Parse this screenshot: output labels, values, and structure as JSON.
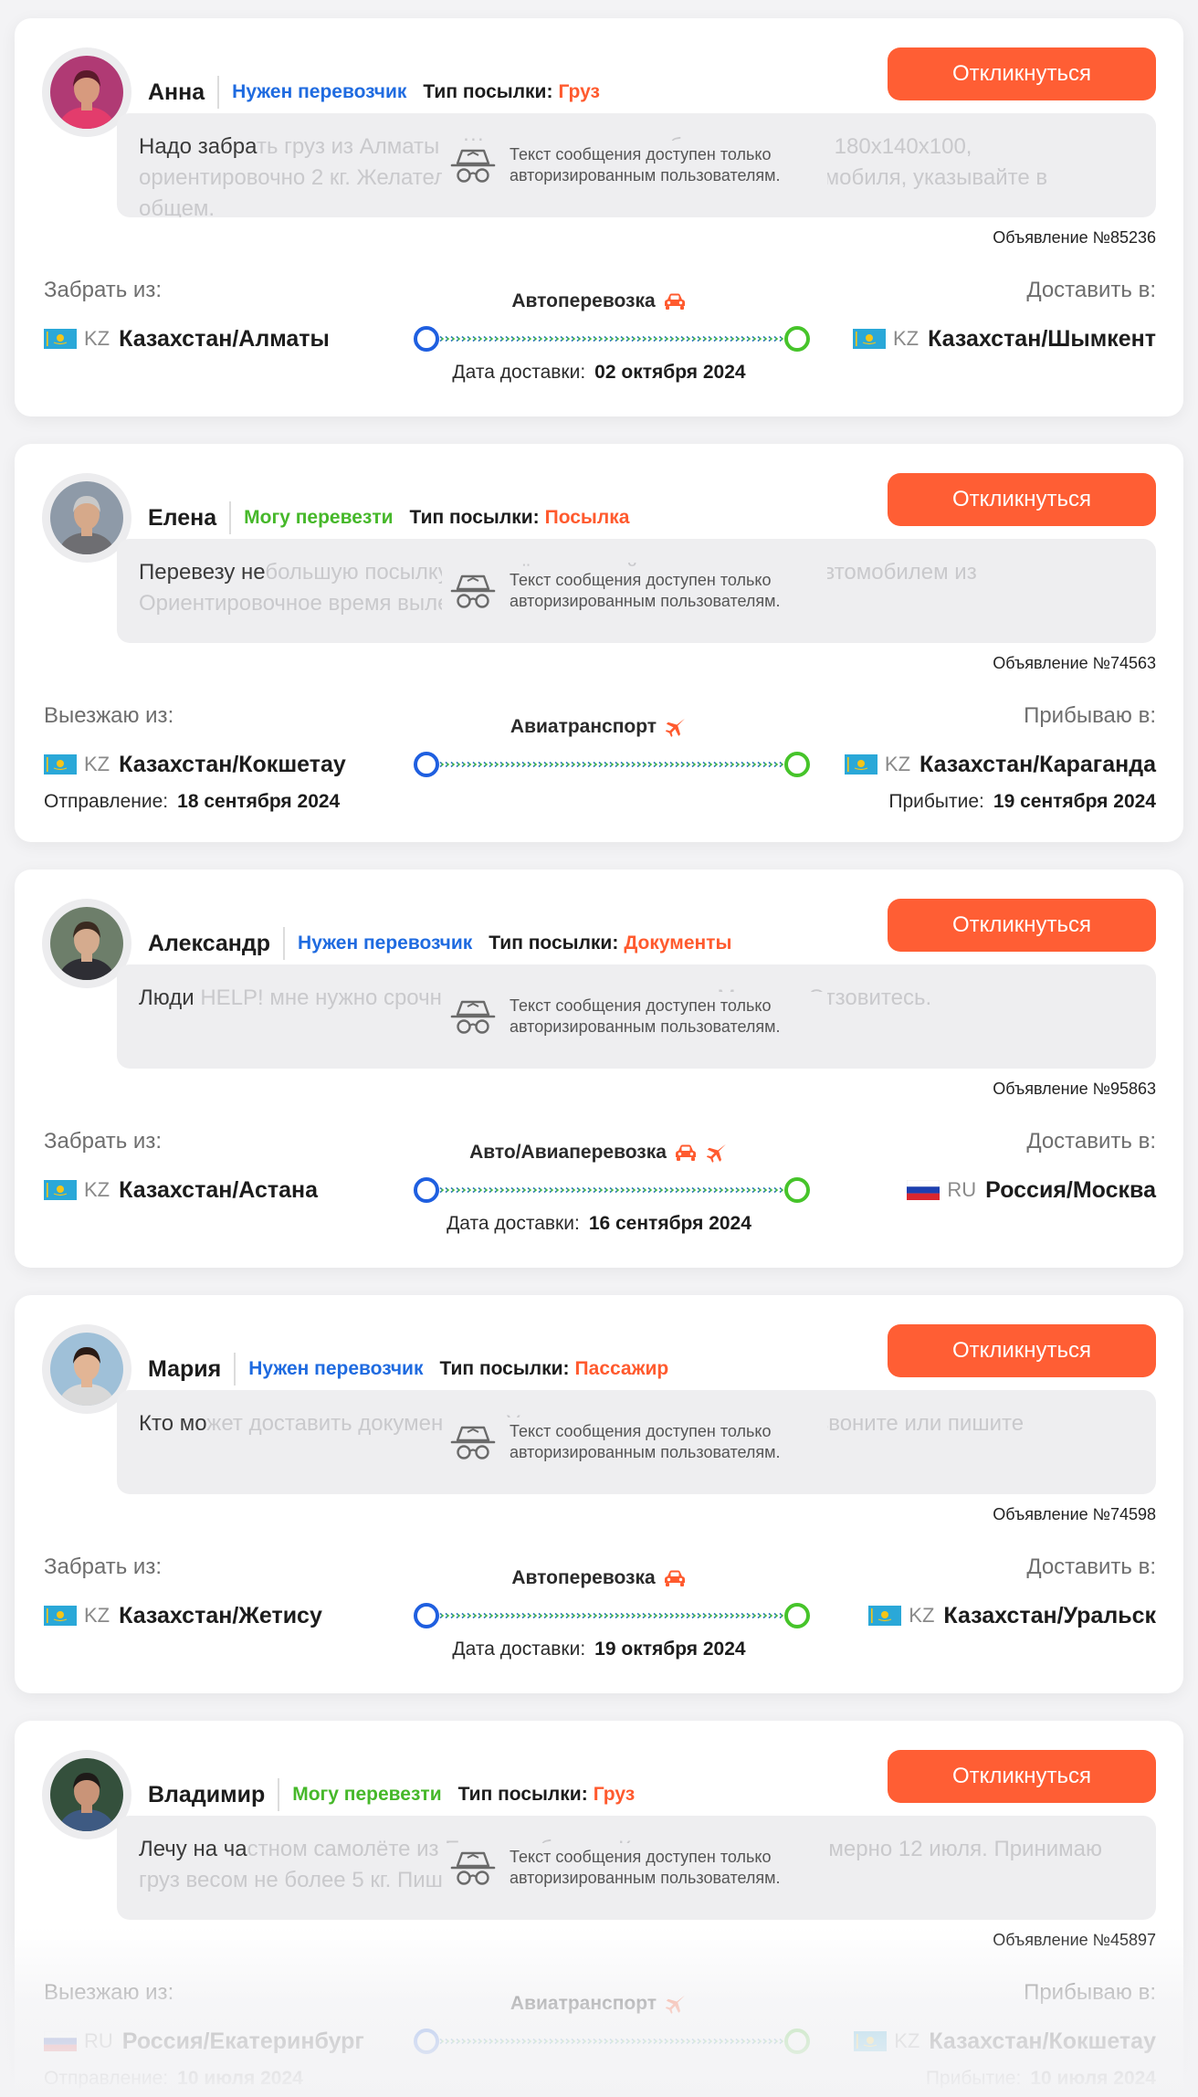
{
  "ui": {
    "respond_label": "Откликнуться",
    "ptype_label": "Тип посылки:",
    "overlay_text": "Текст сообщения доступен только авторизированным пользователям.",
    "colors": {
      "accent": "#ff5e34",
      "need_status": "#1f6be0",
      "can_status": "#46b82a"
    }
  },
  "cards": [
    {
      "name": "Анна",
      "status": "Нужен перевозчик",
      "status_kind": "need",
      "parcel_type": "Груз",
      "message_clear": "Надо забра",
      "message_rest": "ть груз из Алматы в Шымкент, одна коробка с размером 180х140х100, ориентировочно 2 кг. Желательно, контактные данные вашего автомобиля, указывайте в общем.",
      "ad_number": "Объявление №85236",
      "from_label": "Забрать из:",
      "to_label": "Доставить в:",
      "transport": "Автоперевозка",
      "transport_icons": [
        "car-icon"
      ],
      "from": {
        "cc": "KZ",
        "flag": "kz-flag-icon",
        "place": "Казахстан/Алматы"
      },
      "to": {
        "cc": "KZ",
        "flag": "kz-flag-icon",
        "place": "Казахстан/Шымкент"
      },
      "date_mode": "center",
      "date_label": "Дата доставки:",
      "date_value": "02 октября 2024"
    },
    {
      "name": "Елена",
      "status": "Могу перевезти",
      "status_kind": "can",
      "parcel_type": "Посылка",
      "message_clear": "Перевезу не",
      "message_rest": "большую посылку на своём авиарейсе, или передам автомобилем из Ориентировочное время вылета утро, стоимость договорная.",
      "ad_number": "Объявление №74563",
      "from_label": "Выезжаю из:",
      "to_label": "Прибываю в:",
      "transport": "Авиатранспорт",
      "transport_icons": [
        "plane-icon"
      ],
      "from": {
        "cc": "KZ",
        "flag": "kz-flag-icon",
        "place": "Казахстан/Кокшетау"
      },
      "to": {
        "cc": "KZ",
        "flag": "kz-flag-icon",
        "place": "Казахстан/Караганда"
      },
      "date_mode": "split",
      "dep_label": "Отправление:",
      "dep_value": "18 сентября 2024",
      "arr_label": "Прибытие:",
      "arr_value": "19 сентября 2024"
    },
    {
      "name": "Александр",
      "status": "Нужен перевозчик",
      "status_kind": "need",
      "parcel_type": "Документы",
      "message_clear": "Люди ",
      "message_rest": "HELP! мне нужно срочно доставить документы до Москвы. Отзовитесь.",
      "ad_number": "Объявление №95863",
      "from_label": "Забрать из:",
      "to_label": "Доставить в:",
      "transport": "Авто/Авиаперевозка",
      "transport_icons": [
        "car-icon",
        "plane-icon"
      ],
      "from": {
        "cc": "KZ",
        "flag": "kz-flag-icon",
        "place": "Казахстан/Астана"
      },
      "to": {
        "cc": "RU",
        "flag": "ru-flag-icon",
        "place": "Россия/Москва"
      },
      "date_mode": "center",
      "date_label": "Дата доставки:",
      "date_value": "16 сентября 2024"
    },
    {
      "name": "Мария",
      "status": "Нужен перевозчик",
      "status_kind": "need",
      "parcel_type": "Пассажир",
      "message_clear": "Кто мо",
      "message_rest": "жет доставить документы до Уральска, оплата договорная, звоните или пишите",
      "ad_number": "Объявление №74598",
      "from_label": "Забрать из:",
      "to_label": "Доставить в:",
      "transport": "Автоперевозка",
      "transport_icons": [
        "car-icon"
      ],
      "from": {
        "cc": "KZ",
        "flag": "kz-flag-icon",
        "place": "Казахстан/Жетису"
      },
      "to": {
        "cc": "KZ",
        "flag": "kz-flag-icon",
        "place": "Казахстан/Уральск"
      },
      "date_mode": "center",
      "date_label": "Дата доставки:",
      "date_value": "19 октября 2024"
    },
    {
      "name": "Владимир",
      "status": "Могу перевезти",
      "status_kind": "can",
      "parcel_type": "Груз",
      "message_clear": "Лечу на ча",
      "message_rest": "стном самолёте из Екатеринбурга в Кокшетау, вылет примерно 12 июля. Принимаю груз весом не более 5 кг. Пишите.",
      "ad_number": "Объявление №45897",
      "from_label": "Выезжаю из:",
      "to_label": "Прибываю в:",
      "transport": "Авиатранспорт",
      "transport_icons": [
        "plane-icon"
      ],
      "from": {
        "cc": "RU",
        "flag": "ru-flag-icon",
        "place": "Россия/Екатеринбург"
      },
      "to": {
        "cc": "KZ",
        "flag": "kz-flag-icon",
        "place": "Казахстан/Кокшетау"
      },
      "date_mode": "split",
      "dep_label": "Отправление:",
      "dep_value": "10 июля 2024",
      "arr_label": "Прибытие:",
      "arr_value": "10 июля 2024"
    }
  ]
}
